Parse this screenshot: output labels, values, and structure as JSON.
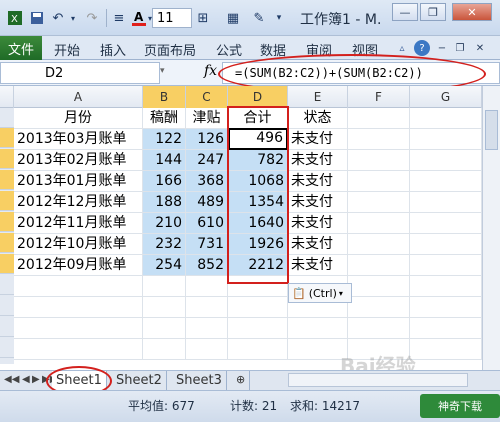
{
  "window": {
    "title": "工作簿1 - M.",
    "font_size_value": "11",
    "minimize_label": "—",
    "restore_label": "❐",
    "close_label": "✕"
  },
  "ribbon": {
    "file_tab": "文件",
    "tabs": [
      "开始",
      "插入",
      "页面布局",
      "公式",
      "数据",
      "审阅",
      "视图"
    ]
  },
  "formula_bar": {
    "name_box": "D2",
    "fx_label": "fx",
    "formula": "=(SUM(B2:C2))+(SUM(B2:C2))"
  },
  "grid": {
    "columns": [
      "A",
      "B",
      "C",
      "D",
      "E",
      "F",
      "G"
    ],
    "header_row": [
      "月份",
      "稿酬",
      "津贴",
      "合计",
      "状态"
    ],
    "rows": [
      [
        "2013年03月账单",
        "122",
        "126",
        "496",
        "未支付"
      ],
      [
        "2013年02月账单",
        "144",
        "247",
        "782",
        "未支付"
      ],
      [
        "2013年01月账单",
        "166",
        "368",
        "1068",
        "未支付"
      ],
      [
        "2012年12月账单",
        "188",
        "489",
        "1354",
        "未支付"
      ],
      [
        "2012年11月账单",
        "210",
        "610",
        "1640",
        "未支付"
      ],
      [
        "2012年10月账单",
        "232",
        "731",
        "1926",
        "未支付"
      ],
      [
        "2012年09月账单",
        "254",
        "852",
        "2212",
        "未支付"
      ]
    ],
    "paste_options": "(Ctrl)"
  },
  "sheets": {
    "tabs": [
      "Sheet1",
      "Sheet2",
      "Sheet3"
    ],
    "active": "Sheet1"
  },
  "status": {
    "average": "平均值: 677",
    "count": "计数: 21",
    "sum": "求和: 14217"
  },
  "watermark": {
    "baidu": "Bai经验",
    "logo": "神奇下载"
  },
  "colors": {
    "accent_red": "#d3201d",
    "highlight_blue": "#c5dff5",
    "header_selected": "#f8cf63",
    "file_tab_green": "#1f6b27"
  }
}
